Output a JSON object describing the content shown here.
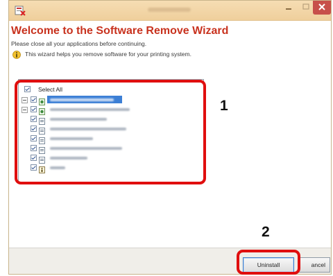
{
  "wizard": {
    "heading": "Welcome to the Software Remove Wizard",
    "instruction": "Please close all your applications before continuing.",
    "info_text": "This wizard helps you remove software for your printing system."
  },
  "software_list": {
    "select_all_label": "Select All",
    "select_all_checked": true,
    "items": [
      {
        "checked": true,
        "expandable": true,
        "selected": true,
        "icon": "app-icon"
      },
      {
        "checked": true,
        "expandable": true,
        "selected": false,
        "icon": "app-icon"
      },
      {
        "checked": true,
        "expandable": false,
        "selected": false,
        "icon": "file-icon"
      },
      {
        "checked": true,
        "expandable": false,
        "selected": false,
        "icon": "file-icon"
      },
      {
        "checked": true,
        "expandable": false,
        "selected": false,
        "icon": "file-icon"
      },
      {
        "checked": true,
        "expandable": false,
        "selected": false,
        "icon": "file-icon"
      },
      {
        "checked": true,
        "expandable": false,
        "selected": false,
        "icon": "file-icon"
      },
      {
        "checked": true,
        "expandable": false,
        "selected": false,
        "icon": "help-file-icon"
      }
    ]
  },
  "buttons": {
    "uninstall": "Uninstall",
    "cancel": "ancel"
  },
  "callouts": {
    "step1": "1",
    "step2": "2"
  },
  "colors": {
    "heading": "#c8321e",
    "highlight": "#e00e0e",
    "selection": "#3c7fd5",
    "titlebar": "#f2d6a8"
  }
}
